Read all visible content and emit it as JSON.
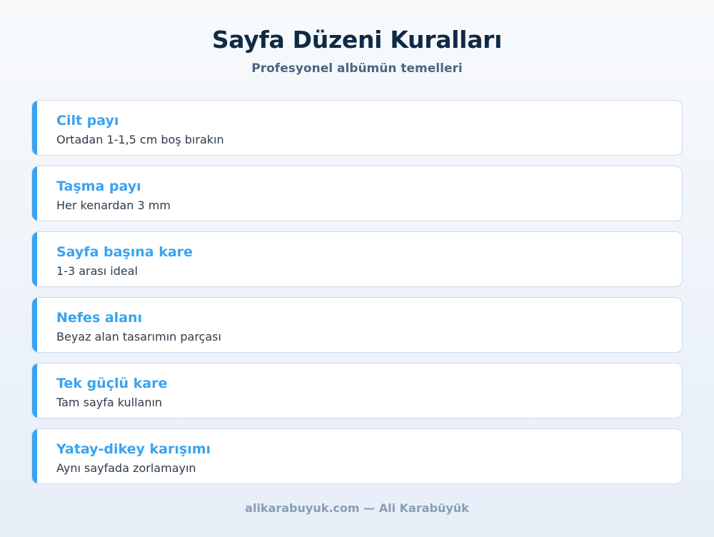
{
  "header": {
    "title": "Sayfa Düzeni Kuralları",
    "subtitle": "Profesyonel albümün temelleri"
  },
  "cards": [
    {
      "title": "Cilt payı",
      "description": "Ortadan 1-1,5 cm boş bırakın"
    },
    {
      "title": "Taşma payı",
      "description": "Her kenardan 3 mm"
    },
    {
      "title": "Sayfa başına kare",
      "description": "1-3 arası ideal"
    },
    {
      "title": "Nefes alanı",
      "description": "Beyaz alan tasarımın parçası"
    },
    {
      "title": "Tek güçlü kare",
      "description": "Tam sayfa kullanın"
    },
    {
      "title": "Yatay-dikey karışımı",
      "description": "Aynı sayfada zorlamayın"
    }
  ],
  "footer": {
    "text": "alikarabuyuk.com — Ali Karabüyük"
  },
  "colors": {
    "accent": "#3aa3f0",
    "title": "#0f2a44",
    "subtitle": "#4a6584"
  }
}
